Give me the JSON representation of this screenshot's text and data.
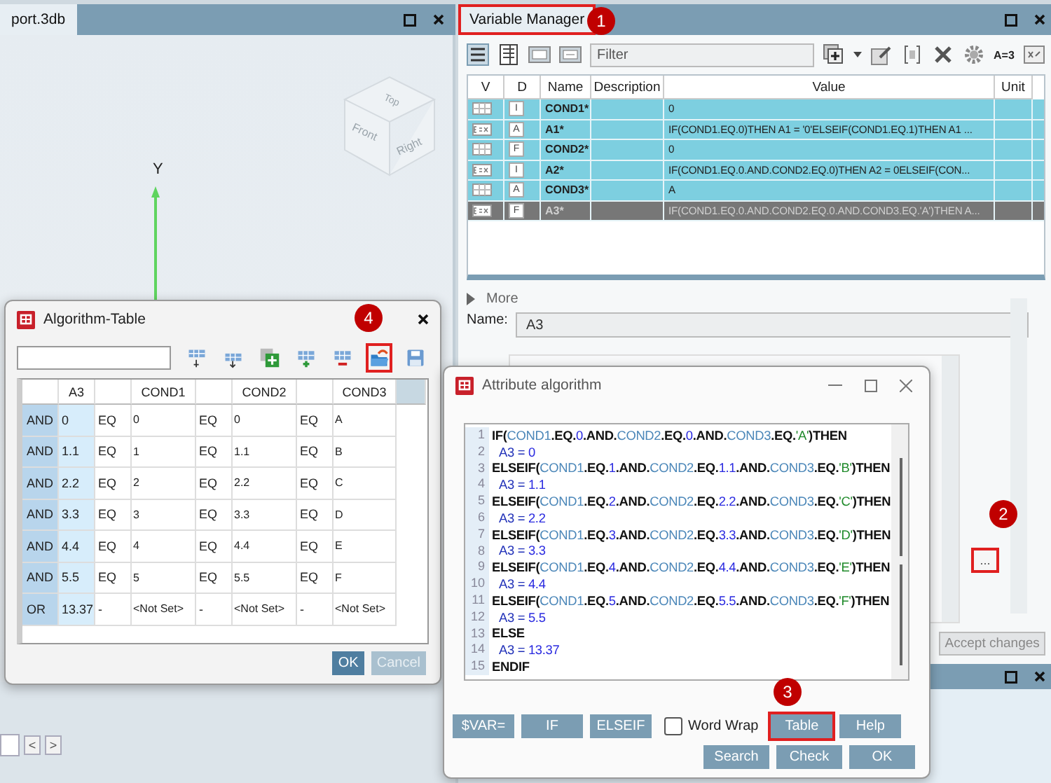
{
  "viewport": {
    "tab": "port.3db",
    "axis_label": "Y",
    "cube_faces": [
      "Top",
      "Front",
      "Right"
    ]
  },
  "bottom_left": {
    "nav_buttons": [
      "<",
      ">"
    ]
  },
  "variable_manager": {
    "tab": {
      "label": "Variable Manager",
      "highlighted": true,
      "callout": "1"
    },
    "filter_placeholder": "Filter",
    "formula_tool": "A=3",
    "columns": [
      "V",
      "D",
      "Name",
      "Description",
      "Value",
      "Unit"
    ],
    "rows": [
      {
        "kind": "table",
        "d": "I",
        "name": "COND1*",
        "value": "0",
        "selected": false
      },
      {
        "kind": "formula",
        "d": "A",
        "name": "A1*",
        "value": "IF(COND1.EQ.0)THEN A1 = '0'ELSEIF(COND1.EQ.1)THEN A1 ...",
        "selected": false
      },
      {
        "kind": "table",
        "d": "F",
        "name": "COND2*",
        "value": "0",
        "selected": false
      },
      {
        "kind": "formula",
        "d": "I",
        "name": "A2*",
        "value": "IF(COND1.EQ.0.AND.COND2.EQ.0)THEN A2 = 0ELSEIF(CON...",
        "selected": false
      },
      {
        "kind": "table",
        "d": "A",
        "name": "COND3*",
        "value": "A",
        "selected": false
      },
      {
        "kind": "formula",
        "d": "F",
        "name": "A3*",
        "value": "IF(COND1.EQ.0.AND.COND2.EQ.0.AND.COND3.EQ.'A')THEN A...",
        "selected": true
      }
    ],
    "more": "More",
    "name_label": "Name:",
    "name_value": "A3",
    "ellipsis_button": {
      "label": "...",
      "highlighted": true,
      "callout": "2"
    },
    "accept_button": {
      "label": "Accept changes",
      "disabled": true
    }
  },
  "algorithm_table": {
    "title": "Algorithm-Table",
    "callout": "4",
    "tools": [
      {
        "kind": "insert-above",
        "highlighted": false
      },
      {
        "kind": "insert-below",
        "highlighted": false
      },
      {
        "kind": "add",
        "highlighted": false
      },
      {
        "kind": "add-row",
        "highlighted": false
      },
      {
        "kind": "remove-row",
        "highlighted": false
      },
      {
        "kind": "open",
        "highlighted": true
      },
      {
        "kind": "save",
        "highlighted": false
      }
    ],
    "columns": [
      "",
      "A3",
      "",
      "COND1",
      "",
      "COND2",
      "",
      "COND3"
    ],
    "rows": [
      [
        "AND",
        "0",
        "EQ",
        "0",
        "EQ",
        "0",
        "EQ",
        "A"
      ],
      [
        "AND",
        "1.1",
        "EQ",
        "1",
        "EQ",
        "1.1",
        "EQ",
        "B"
      ],
      [
        "AND",
        "2.2",
        "EQ",
        "2",
        "EQ",
        "2.2",
        "EQ",
        "C"
      ],
      [
        "AND",
        "3.3",
        "EQ",
        "3",
        "EQ",
        "3.3",
        "EQ",
        "D"
      ],
      [
        "AND",
        "4.4",
        "EQ",
        "4",
        "EQ",
        "4.4",
        "EQ",
        "E"
      ],
      [
        "AND",
        "5.5",
        "EQ",
        "5",
        "EQ",
        "5.5",
        "EQ",
        "F"
      ],
      [
        "OR",
        "13.37",
        "-",
        "<Not Set>",
        "-",
        "<Not Set>",
        "-",
        "<Not Set>"
      ]
    ],
    "ok_button": {
      "label": "OK",
      "disabled": false
    },
    "cancel_button": {
      "label": "Cancel",
      "disabled": true
    }
  },
  "attribute_algorithm": {
    "title": "Attribute algorithm",
    "lines": [
      {
        "number": "1",
        "indent": false,
        "tokens": [
          {
            "text": "IF(",
            "kind": "kw"
          },
          {
            "text": "COND1",
            "kind": "var"
          },
          {
            "text": ".EQ.",
            "kind": "kw"
          },
          {
            "text": "0",
            "kind": "num"
          },
          {
            "text": ".AND.",
            "kind": "kw"
          },
          {
            "text": "COND2",
            "kind": "var"
          },
          {
            "text": ".EQ.",
            "kind": "kw"
          },
          {
            "text": "0",
            "kind": "num"
          },
          {
            "text": ".AND.",
            "kind": "kw"
          },
          {
            "text": "COND3",
            "kind": "var"
          },
          {
            "text": ".EQ.",
            "kind": "kw"
          },
          {
            "text": "'A'",
            "kind": "str"
          },
          {
            "text": ")THEN",
            "kind": "kw"
          }
        ]
      },
      {
        "number": "2",
        "indent": true,
        "tokens": [
          {
            "text": "A3 = ",
            "kind": "asg"
          },
          {
            "text": "0",
            "kind": "num"
          }
        ]
      },
      {
        "number": "3",
        "indent": false,
        "tokens": [
          {
            "text": "ELSEIF(",
            "kind": "kw"
          },
          {
            "text": "COND1",
            "kind": "var"
          },
          {
            "text": ".EQ.",
            "kind": "kw"
          },
          {
            "text": "1",
            "kind": "num"
          },
          {
            "text": ".AND.",
            "kind": "kw"
          },
          {
            "text": "COND2",
            "kind": "var"
          },
          {
            "text": ".EQ.",
            "kind": "kw"
          },
          {
            "text": "1.1",
            "kind": "num"
          },
          {
            "text": ".AND.",
            "kind": "kw"
          },
          {
            "text": "COND3",
            "kind": "var"
          },
          {
            "text": ".EQ.",
            "kind": "kw"
          },
          {
            "text": "'B'",
            "kind": "str"
          },
          {
            "text": ")THEN",
            "kind": "kw"
          }
        ]
      },
      {
        "number": "4",
        "indent": true,
        "tokens": [
          {
            "text": "A3 = ",
            "kind": "asg"
          },
          {
            "text": "1.1",
            "kind": "num"
          }
        ]
      },
      {
        "number": "5",
        "indent": false,
        "tokens": [
          {
            "text": "ELSEIF(",
            "kind": "kw"
          },
          {
            "text": "COND1",
            "kind": "var"
          },
          {
            "text": ".EQ.",
            "kind": "kw"
          },
          {
            "text": "2",
            "kind": "num"
          },
          {
            "text": ".AND.",
            "kind": "kw"
          },
          {
            "text": "COND2",
            "kind": "var"
          },
          {
            "text": ".EQ.",
            "kind": "kw"
          },
          {
            "text": "2.2",
            "kind": "num"
          },
          {
            "text": ".AND.",
            "kind": "kw"
          },
          {
            "text": "COND3",
            "kind": "var"
          },
          {
            "text": ".EQ.",
            "kind": "kw"
          },
          {
            "text": "'C'",
            "kind": "str"
          },
          {
            "text": ")THEN",
            "kind": "kw"
          }
        ]
      },
      {
        "number": "6",
        "indent": true,
        "tokens": [
          {
            "text": "A3 = ",
            "kind": "asg"
          },
          {
            "text": "2.2",
            "kind": "num"
          }
        ]
      },
      {
        "number": "7",
        "indent": false,
        "tokens": [
          {
            "text": "ELSEIF(",
            "kind": "kw"
          },
          {
            "text": "COND1",
            "kind": "var"
          },
          {
            "text": ".EQ.",
            "kind": "kw"
          },
          {
            "text": "3",
            "kind": "num"
          },
          {
            "text": ".AND.",
            "kind": "kw"
          },
          {
            "text": "COND2",
            "kind": "var"
          },
          {
            "text": ".EQ.",
            "kind": "kw"
          },
          {
            "text": "3.3",
            "kind": "num"
          },
          {
            "text": ".AND.",
            "kind": "kw"
          },
          {
            "text": "COND3",
            "kind": "var"
          },
          {
            "text": ".EQ.",
            "kind": "kw"
          },
          {
            "text": "'D'",
            "kind": "str"
          },
          {
            "text": ")THEN",
            "kind": "kw"
          }
        ]
      },
      {
        "number": "8",
        "indent": true,
        "tokens": [
          {
            "text": "A3 = ",
            "kind": "asg"
          },
          {
            "text": "3.3",
            "kind": "num"
          }
        ]
      },
      {
        "number": "9",
        "indent": false,
        "tokens": [
          {
            "text": "ELSEIF(",
            "kind": "kw"
          },
          {
            "text": "COND1",
            "kind": "var"
          },
          {
            "text": ".EQ.",
            "kind": "kw"
          },
          {
            "text": "4",
            "kind": "num"
          },
          {
            "text": ".AND.",
            "kind": "kw"
          },
          {
            "text": "COND2",
            "kind": "var"
          },
          {
            "text": ".EQ.",
            "kind": "kw"
          },
          {
            "text": "4.4",
            "kind": "num"
          },
          {
            "text": ".AND.",
            "kind": "kw"
          },
          {
            "text": "COND3",
            "kind": "var"
          },
          {
            "text": ".EQ.",
            "kind": "kw"
          },
          {
            "text": "'E'",
            "kind": "str"
          },
          {
            "text": ")THEN",
            "kind": "kw"
          }
        ]
      },
      {
        "number": "10",
        "indent": true,
        "tokens": [
          {
            "text": "A3 = ",
            "kind": "asg"
          },
          {
            "text": "4.4",
            "kind": "num"
          }
        ]
      },
      {
        "number": "11",
        "indent": false,
        "tokens": [
          {
            "text": "ELSEIF(",
            "kind": "kw"
          },
          {
            "text": "COND1",
            "kind": "var"
          },
          {
            "text": ".EQ.",
            "kind": "kw"
          },
          {
            "text": "5",
            "kind": "num"
          },
          {
            "text": ".AND.",
            "kind": "kw"
          },
          {
            "text": "COND2",
            "kind": "var"
          },
          {
            "text": ".EQ.",
            "kind": "kw"
          },
          {
            "text": "5.5",
            "kind": "num"
          },
          {
            "text": ".AND.",
            "kind": "kw"
          },
          {
            "text": "COND3",
            "kind": "var"
          },
          {
            "text": ".EQ.",
            "kind": "kw"
          },
          {
            "text": "'F'",
            "kind": "str"
          },
          {
            "text": ")THEN",
            "kind": "kw"
          }
        ]
      },
      {
        "number": "12",
        "indent": true,
        "tokens": [
          {
            "text": "A3 = ",
            "kind": "asg"
          },
          {
            "text": "5.5",
            "kind": "num"
          }
        ]
      },
      {
        "number": "13",
        "indent": false,
        "tokens": [
          {
            "text": "ELSE",
            "kind": "kw"
          }
        ]
      },
      {
        "number": "14",
        "indent": true,
        "tokens": [
          {
            "text": "A3 = ",
            "kind": "asg"
          },
          {
            "text": "13.37",
            "kind": "num"
          }
        ]
      },
      {
        "number": "15",
        "indent": false,
        "tokens": [
          {
            "text": "ENDIF",
            "kind": "kw"
          }
        ]
      }
    ],
    "insert_buttons": [
      "$VAR=",
      "IF",
      "ELSEIF"
    ],
    "word_wrap": {
      "label": "Word Wrap",
      "checked": false
    },
    "right_buttons": [
      {
        "label": "Table",
        "highlighted": true,
        "callout": "3"
      },
      {
        "label": "Help",
        "highlighted": false
      }
    ],
    "bottom_buttons": [
      "Search",
      "Check",
      "OK"
    ]
  }
}
